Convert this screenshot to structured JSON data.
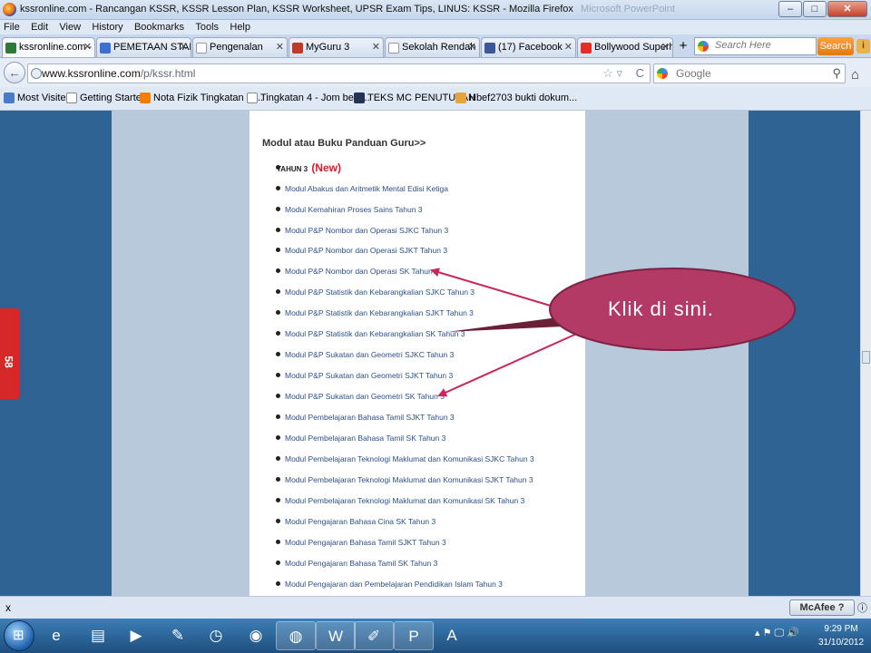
{
  "window": {
    "title": "kssronline.com - Rancangan KSSR, KSSR Lesson Plan, KSSR Worksheet, UPSR Exam Tips, LINUS: KSSR - Mozilla Firefox",
    "background_app_title": "Microsoft PowerPoint",
    "minimize": "–",
    "maximize": "□",
    "close": "✕"
  },
  "menu": [
    "File",
    "Edit",
    "View",
    "History",
    "Bookmarks",
    "Tools",
    "Help"
  ],
  "tabs": [
    {
      "label": "kssronline.com - R...",
      "icon_color": "#2d7a36"
    },
    {
      "label": "PEMETAAN STAN...",
      "icon_color": "#3d6fd1"
    },
    {
      "label": "Pengenalan",
      "icon_color": "#ffffff"
    },
    {
      "label": "MyGuru 3",
      "icon_color": "#c0392b"
    },
    {
      "label": "Sekolah Rendah Isl...",
      "icon_color": "#ffffff"
    },
    {
      "label": "(17) Facebook",
      "icon_color": "#3b5998"
    },
    {
      "label": "Bollywood Superh...",
      "icon_color": "#e52d27"
    }
  ],
  "tab_close": "✕",
  "new_tab": "+",
  "search_engine_box": {
    "placeholder": "Search Here",
    "button": "Search"
  },
  "nav": {
    "url_host": "www.kssronline.com",
    "url_path": "/p/kssr.html",
    "back": "←",
    "star": "☆ ▿",
    "reload": "C",
    "search_placeholder": "Google",
    "search_icon": "⚲",
    "home": "⌂"
  },
  "bookmarks": [
    {
      "label": "Most Visited",
      "icon_color": "#4a7ac8"
    },
    {
      "label": "Getting Started",
      "icon_color": "#ffffff"
    },
    {
      "label": "Nota Fizik Tingkatan 4 ...",
      "icon_color": "#f57d00"
    },
    {
      "label": "Tingkatan 4 - Jom bela...",
      "icon_color": "#ffffff"
    },
    {
      "label": "TEKS MC PENUTUPAN",
      "icon_color": "#223355"
    },
    {
      "label": "Hbef2703 bukti dokum...",
      "icon_color": "#e8a33c"
    }
  ],
  "page": {
    "heading": "Modul atau Buku Panduan Guru>>",
    "year_label": "TAHUN 3",
    "new_label": "(New)",
    "links": [
      "Modul Abakus dan Aritmetik Mental Edisi Ketiga",
      "Modul Kemahiran Proses Sains Tahun 3",
      "Modul P&P Nombor dan Operasi SJKC Tahun 3",
      "Modul P&P Nombor dan Operasi SJKT Tahun 3",
      "Modul P&P Nombor dan Operasi SK Tahun 3",
      "Modul P&P Statistik dan Kebarangkalian SJKC Tahun 3",
      "Modul P&P Statistik dan Kebarangkalian SJKT Tahun 3",
      "Modul P&P Statistik dan Kebarangkalian SK Tahun 3",
      "Modul P&P Sukatan dan Geometri SJKC Tahun 3",
      "Modul P&P Sukatan dan Geometri SJKT Tahun 3",
      "Modul P&P Sukatan dan Geometri SK Tahun 3",
      "Modul Pembelajaran Bahasa Tamil SJKT Tahun 3",
      "Modul Pembelajaran Bahasa Tamil SK Tahun 3",
      "Modul Pembelajaran Teknologi Maklumat dan Komunikasi SJKC Tahun 3",
      "Modul Pembelajaran Teknologi Maklumat dan Komunikasi SJKT Tahun 3",
      "Modul Pembelajaran Teknologi Maklumat dan Komunikasi SK Tahun 3",
      "Modul Pengajaran Bahasa Cina SK Tahun 3",
      "Modul Pengajaran Bahasa Tamil SJKT Tahun 3",
      "Modul Pengajaran Bahasa Tamil SK Tahun 3",
      "Modul Pengajaran dan Pembelajaran Pendidikan Islam Tahun 3"
    ]
  },
  "callout": {
    "text": "Klik di sini.",
    "fill": "#b23a64",
    "arrow_color": "#c8285a"
  },
  "side_badge": "58",
  "statusbar": {
    "close": "x",
    "mcafee": "McAfee ?",
    "info": "ⓘ"
  },
  "taskbar": {
    "start": "⊞",
    "apps": [
      {
        "name": "internet-explorer",
        "glyph": "e"
      },
      {
        "name": "folder",
        "glyph": "▤"
      },
      {
        "name": "media-player",
        "glyph": "▶"
      },
      {
        "name": "pin",
        "glyph": "✎"
      },
      {
        "name": "clock",
        "glyph": "◷"
      },
      {
        "name": "chrome",
        "glyph": "◉"
      },
      {
        "name": "firefox",
        "glyph": "◍"
      },
      {
        "name": "word",
        "glyph": "W"
      },
      {
        "name": "paint",
        "glyph": "✐"
      },
      {
        "name": "powerpoint",
        "glyph": "P"
      },
      {
        "name": "acrobat",
        "glyph": "A"
      }
    ],
    "tray": "▴ ⚑ 🖵 🔊",
    "time": "9:29 PM",
    "date": "31/10/2012"
  }
}
